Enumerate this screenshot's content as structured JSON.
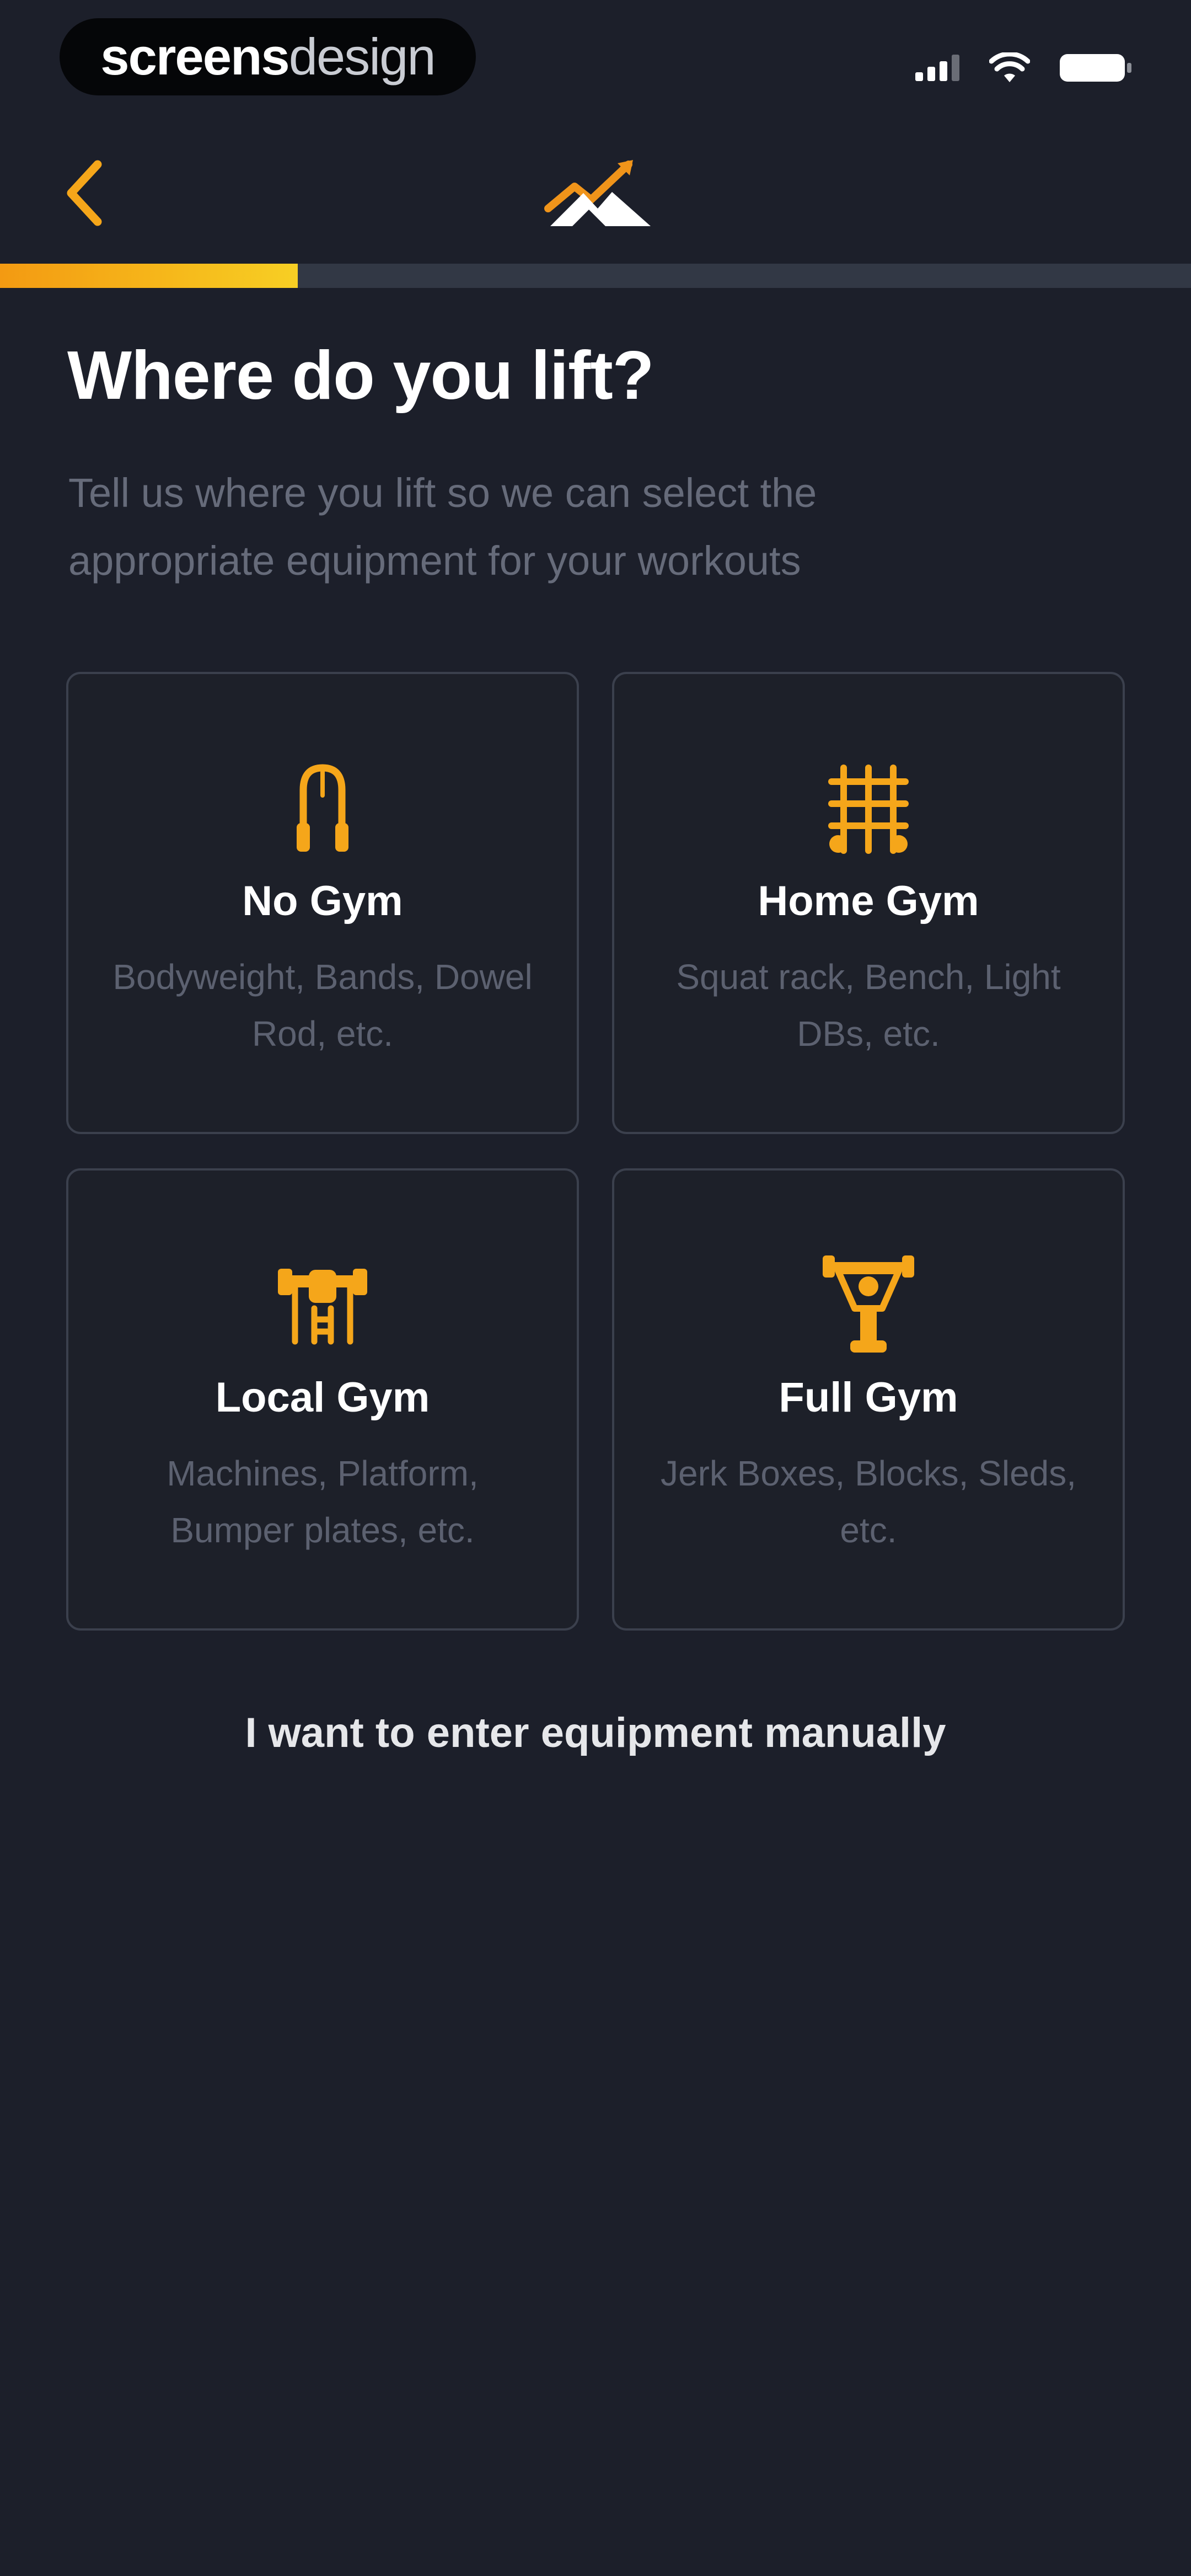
{
  "colors": {
    "background": "#1c1f2a",
    "accent": "#f5a61a",
    "card_border": "#3b404d",
    "muted_text": "#666b7a",
    "progress_track": "#323845"
  },
  "status_bar": {
    "brand_part_a": "screens",
    "brand_part_b": "design",
    "icons": [
      "signal-icon",
      "wifi-icon",
      "battery-icon"
    ]
  },
  "header": {
    "back_icon": "chevron-left-icon",
    "logo_icon": "mountain-logo-icon"
  },
  "progress": {
    "value": 0.25
  },
  "main": {
    "title": "Where do you lift?",
    "subtitle": "Tell us where you lift so we can select the appropriate equipment for your workouts"
  },
  "options": [
    {
      "icon": "jump-rope-icon",
      "title": "No Gym",
      "description": "Bodyweight, Bands, Dowel Rod, etc."
    },
    {
      "icon": "squat-rack-icon",
      "title": "Home Gym",
      "description": "Squat rack, Bench, Light DBs, etc."
    },
    {
      "icon": "weight-machine-icon",
      "title": "Local Gym",
      "description": "Machines, Platform, Bumper plates, etc."
    },
    {
      "icon": "barbell-trophy-icon",
      "title": "Full Gym",
      "description": "Jerk Boxes, Blocks, Sleds, etc."
    }
  ],
  "manual_link": "I want to enter equipment manually"
}
